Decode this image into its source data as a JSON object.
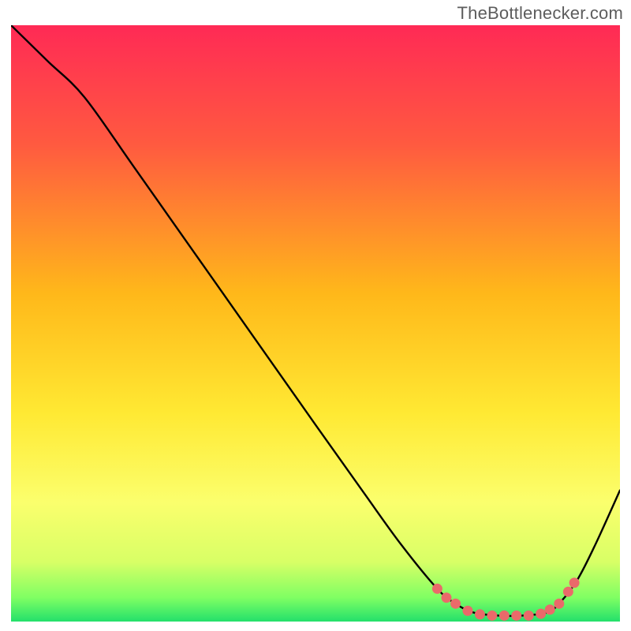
{
  "attribution": "TheBottlenecker.com",
  "chart_data": {
    "type": "line",
    "title": "",
    "xlabel": "",
    "ylabel": "",
    "xlim": [
      0,
      100
    ],
    "ylim": [
      0,
      100
    ],
    "gradient_stops": [
      {
        "offset": 0.0,
        "color": "#ff2a55"
      },
      {
        "offset": 0.2,
        "color": "#ff5a40"
      },
      {
        "offset": 0.45,
        "color": "#ffb81a"
      },
      {
        "offset": 0.65,
        "color": "#ffe933"
      },
      {
        "offset": 0.8,
        "color": "#fbff6d"
      },
      {
        "offset": 0.9,
        "color": "#d8ff66"
      },
      {
        "offset": 0.96,
        "color": "#7fff63"
      },
      {
        "offset": 1.0,
        "color": "#23e06b"
      }
    ],
    "series": [
      {
        "name": "bottleneck-curve",
        "x": [
          0.0,
          6.0,
          12.0,
          20.0,
          30.0,
          40.0,
          50.0,
          58.0,
          64.0,
          70.0,
          73.0,
          76.0,
          80.0,
          84.0,
          88.0,
          90.0,
          93.0,
          96.0,
          100.0
        ],
        "y": [
          100.0,
          94.0,
          88.0,
          76.5,
          62.0,
          47.5,
          33.0,
          21.5,
          13.0,
          5.5,
          3.0,
          1.5,
          1.0,
          1.0,
          1.5,
          3.0,
          7.0,
          13.0,
          22.0
        ]
      }
    ],
    "markers": {
      "name": "highlight-dots",
      "color": "#ea6a6a",
      "points": [
        {
          "x": 70.0,
          "y": 5.5
        },
        {
          "x": 71.5,
          "y": 4.0
        },
        {
          "x": 73.0,
          "y": 3.0
        },
        {
          "x": 75.0,
          "y": 1.8
        },
        {
          "x": 77.0,
          "y": 1.2
        },
        {
          "x": 79.0,
          "y": 1.0
        },
        {
          "x": 81.0,
          "y": 1.0
        },
        {
          "x": 83.0,
          "y": 1.0
        },
        {
          "x": 85.0,
          "y": 1.0
        },
        {
          "x": 87.0,
          "y": 1.3
        },
        {
          "x": 88.5,
          "y": 2.0
        },
        {
          "x": 90.0,
          "y": 3.0
        },
        {
          "x": 91.5,
          "y": 5.0
        },
        {
          "x": 92.5,
          "y": 6.5
        }
      ]
    }
  }
}
